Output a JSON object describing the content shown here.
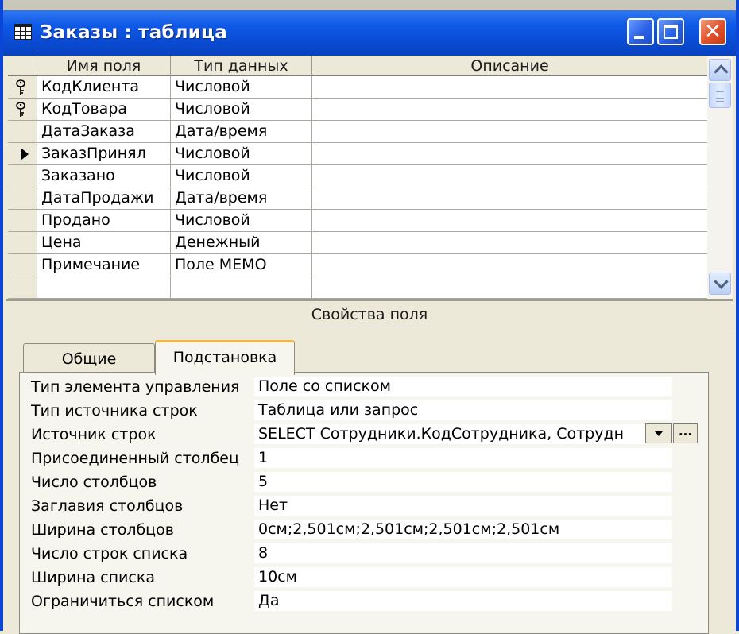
{
  "window": {
    "title": "Заказы : таблица"
  },
  "grid": {
    "headers": {
      "name": "Имя поля",
      "type": "Тип данных",
      "desc": "Описание"
    },
    "rows": [
      {
        "name": "КодКлиента",
        "type": "Числовой",
        "desc": "",
        "key": true
      },
      {
        "name": "КодТовара",
        "type": "Числовой",
        "desc": "",
        "key": true
      },
      {
        "name": "ДатаЗаказа",
        "type": "Дата/время",
        "desc": ""
      },
      {
        "name": "ЗаказПринял",
        "type": "Числовой",
        "desc": "",
        "current": true
      },
      {
        "name": "Заказано",
        "type": "Числовой",
        "desc": ""
      },
      {
        "name": "ДатаПродажи",
        "type": "Дата/время",
        "desc": ""
      },
      {
        "name": "Продано",
        "type": "Числовой",
        "desc": ""
      },
      {
        "name": "Цена",
        "type": "Денежный",
        "desc": ""
      },
      {
        "name": "Примечание",
        "type": "Поле МЕМО",
        "desc": ""
      },
      {
        "name": "",
        "type": "",
        "desc": ""
      }
    ]
  },
  "props": {
    "title": "Свойства поля",
    "tabs": {
      "general": "Общие",
      "lookup": "Подстановка"
    },
    "rows": [
      {
        "label": "Тип элемента управления",
        "value": "Поле со списком"
      },
      {
        "label": "Тип источника строк",
        "value": "Таблица или запрос"
      },
      {
        "label": "Источник строк",
        "value": "SELECT Сотрудники.КодСотрудника, Сотрудн",
        "has_buttons": true
      },
      {
        "label": "Присоединенный столбец",
        "value": "1"
      },
      {
        "label": "Число столбцов",
        "value": "5"
      },
      {
        "label": "Заглавия столбцов",
        "value": "Нет"
      },
      {
        "label": "Ширина столбцов",
        "value": "0см;2,501см;2,501см;2,501см;2,501см"
      },
      {
        "label": "Число строк списка",
        "value": "8"
      },
      {
        "label": "Ширина списка",
        "value": "10см"
      },
      {
        "label": "Ограничиться списком",
        "value": "Да"
      }
    ],
    "build_label": "..."
  }
}
